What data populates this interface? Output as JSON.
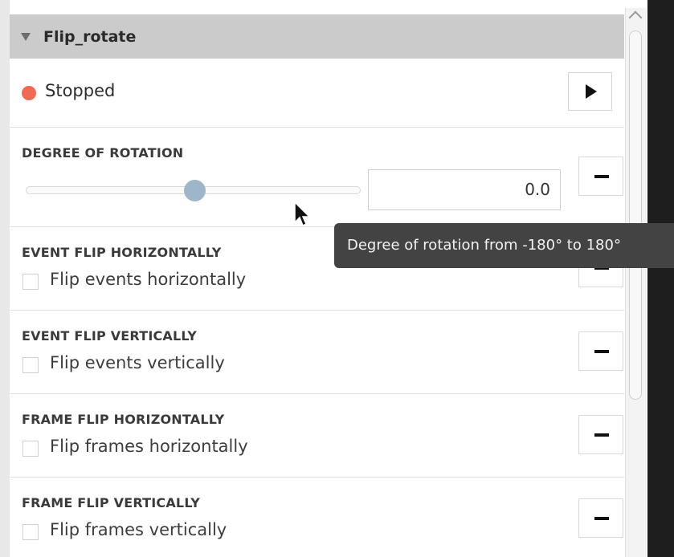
{
  "module": {
    "title": "Flip_rotate"
  },
  "status": {
    "text": "Stopped",
    "color": "#ee6a55"
  },
  "play_button": {
    "icon": "play-icon"
  },
  "rotation": {
    "label": "DEGREE OF ROTATION",
    "value": "0.0",
    "slider_fraction": 0.5,
    "tooltip": "Degree of rotation from -180° to 180°"
  },
  "params": [
    {
      "label": "EVENT FLIP HORIZONTALLY",
      "checkbox_label": "Flip events horizontally",
      "checked": false
    },
    {
      "label": "EVENT FLIP VERTICALLY",
      "checkbox_label": "Flip events vertically",
      "checked": false
    },
    {
      "label": "FRAME FLIP HORIZONTALLY",
      "checkbox_label": "Flip frames horizontally",
      "checked": false
    },
    {
      "label": "FRAME FLIP VERTICALLY",
      "checkbox_label": "Flip frames vertically",
      "checked": false
    }
  ],
  "colors": {
    "header": "#cbcbcb",
    "slider_thumb": "#9fb5c8",
    "tooltip_bg": "#434343"
  }
}
